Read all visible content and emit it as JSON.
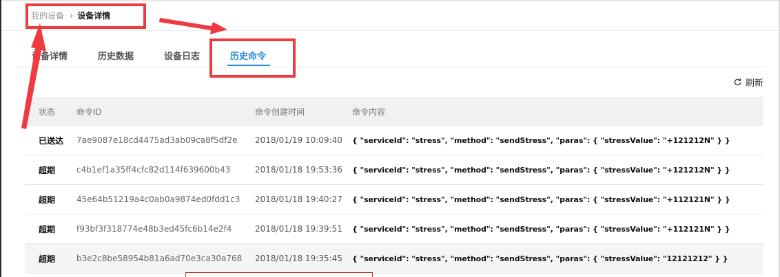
{
  "breadcrumb": {
    "parent": "我的设备",
    "separator": "›",
    "current": "设备详情"
  },
  "tabs": [
    {
      "label": "设备详情",
      "active": false
    },
    {
      "label": "历史数据",
      "active": false
    },
    {
      "label": "设备日志",
      "active": false
    },
    {
      "label": "历史命令",
      "active": true
    }
  ],
  "toolbar": {
    "refresh_label": "刷新",
    "refresh_icon": "refresh-icon"
  },
  "table": {
    "columns": [
      "状态",
      "命令ID",
      "命令创建时间",
      "命令内容"
    ],
    "rows": [
      {
        "status": "已送达",
        "id": "7ae9087e18cd4475ad3ab09ca8f5df2e",
        "time": "2018/01/19 10:09:40",
        "content": "{ \"serviceId\": \"stress\", \"method\": \"sendStress\", \"paras\": { \"stressValue\": \"+121212N\" } }"
      },
      {
        "status": "超期",
        "id": "c4b1ef1a35ff4cfc82d114f639600b43",
        "time": "2018/01/18 19:53:36",
        "content": "{ \"serviceId\": \"stress\", \"method\": \"sendStress\", \"paras\": { \"stressValue\": \"+121212N\" } }"
      },
      {
        "status": "超期",
        "id": "45e64b51219a4c0ab0a9874ed0fdd1c3",
        "time": "2018/01/18 19:40:27",
        "content": "{ \"serviceId\": \"stress\", \"method\": \"sendStress\", \"paras\": { \"stressValue\": \"+112121N\" } }"
      },
      {
        "status": "超期",
        "id": "f93bf3f318774e48b3ed45fc6b14e2f4",
        "time": "2018/01/18 19:39:51",
        "content": "{ \"serviceId\": \"stress\", \"method\": \"sendStress\", \"paras\": { \"stressValue\": \"+112121N\" } }"
      },
      {
        "status": "超期",
        "id": "b3e2c8be58954b81a6ad70e3ca30a768",
        "time": "2018/01/18 19:35:45",
        "content": "{ \"serviceId\": \"stress\", \"method\": \"sendStress\", \"paras\": { \"stressValue\": \"12121212\" } }"
      }
    ]
  },
  "colors": {
    "accent": "#2a8ed8",
    "annotation": "#ef3a3f",
    "header_bg": "#f1f1f2"
  }
}
